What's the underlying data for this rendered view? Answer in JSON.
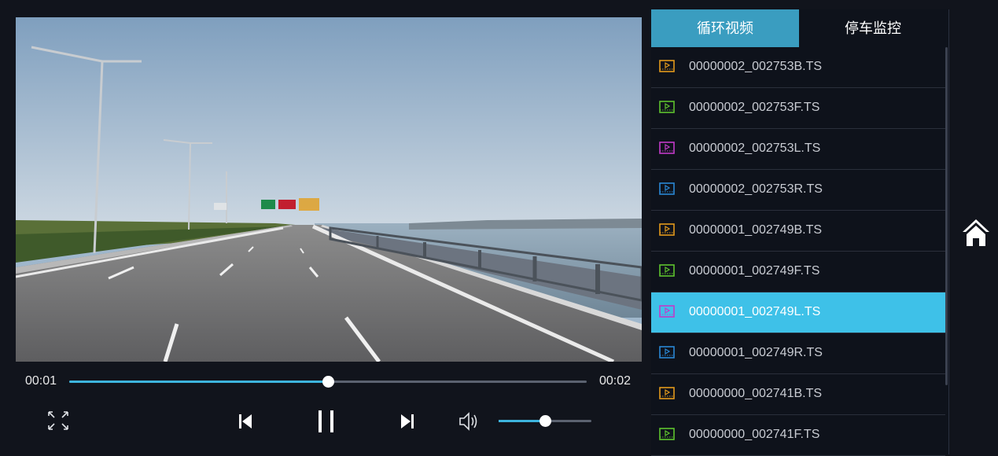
{
  "player": {
    "current_time": "00:01",
    "duration": "00:02",
    "progress": 0.5,
    "volume": 0.5
  },
  "tabs": [
    {
      "label": "循环视频",
      "active": true
    },
    {
      "label": "停车监控",
      "active": false
    }
  ],
  "files": [
    {
      "name": "00000002_002753B.TS",
      "color": "#e39a1c",
      "selected": false
    },
    {
      "name": "00000002_002753F.TS",
      "color": "#5fc32e",
      "selected": false
    },
    {
      "name": "00000002_002753L.TS",
      "color": "#c23ac9",
      "selected": false
    },
    {
      "name": "00000002_002753R.TS",
      "color": "#2a88d6",
      "selected": false
    },
    {
      "name": "00000001_002749B.TS",
      "color": "#e39a1c",
      "selected": false
    },
    {
      "name": "00000001_002749F.TS",
      "color": "#5fc32e",
      "selected": false
    },
    {
      "name": "00000001_002749L.TS",
      "color": "#c23ac9",
      "selected": true
    },
    {
      "name": "00000001_002749R.TS",
      "color": "#2a88d6",
      "selected": false
    },
    {
      "name": "00000000_002741B.TS",
      "color": "#e39a1c",
      "selected": false
    },
    {
      "name": "00000000_002741F.TS",
      "color": "#5fc32e",
      "selected": false
    }
  ],
  "icons": {
    "fullscreen": "fullscreen-icon",
    "previous": "skip-previous-icon",
    "pause": "pause-icon",
    "next": "skip-next-icon",
    "volume": "volume-icon",
    "home": "home-icon",
    "file": "video-file-icon"
  },
  "colors": {
    "accent": "#3db4dd",
    "tab_active": "#3a9dc0",
    "row_selected": "#3ec1e8",
    "background": "#11141c"
  }
}
